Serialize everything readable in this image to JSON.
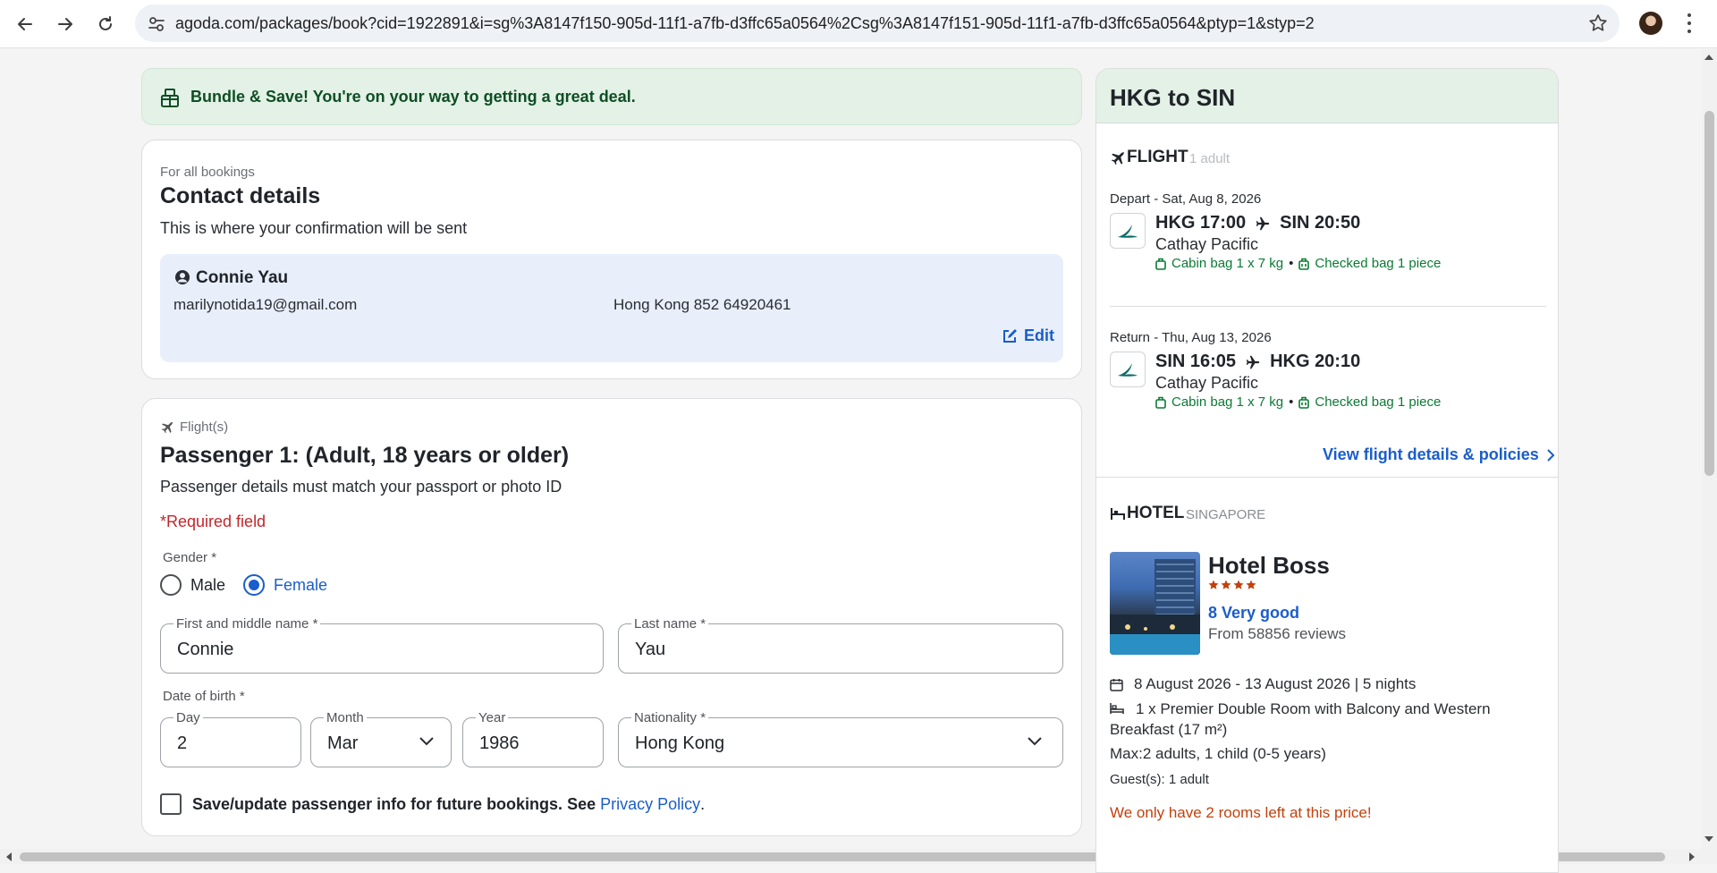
{
  "browser": {
    "url": "agoda.com/packages/book?cid=1922891&i=sg%3A8147f150-905d-11f1-a7fb-d3ffc65a0564%2Csg%3A8147f151-905d-11f1-a7fb-d3ffc65a0564&ptyp=1&styp=2"
  },
  "banner": {
    "text": "Bundle & Save! You're on your way to getting a great deal."
  },
  "contact": {
    "overline": "For all bookings",
    "title": "Contact details",
    "subtitle": "This is where your confirmation will be sent",
    "name": "Connie Yau",
    "email": "marilynotida19@gmail.com",
    "phone": "Hong Kong 852 64920461",
    "edit_label": "Edit"
  },
  "passenger": {
    "overline": "Flight(s)",
    "title": "Passenger 1: (Adult, 18 years or older)",
    "subtitle": "Passenger details must match your passport or photo ID",
    "required_note": "*Required field",
    "gender_label": "Gender *",
    "gender_options": [
      "Male",
      "Female"
    ],
    "gender_selected": "Female",
    "first_name_label": "First and middle name *",
    "first_name_value": "Connie",
    "last_name_label": "Last name *",
    "last_name_value": "Yau",
    "dob_label": "Date of birth *",
    "day_label": "Day",
    "day_value": "2",
    "month_label": "Month",
    "month_value": "Mar",
    "year_label": "Year",
    "year_value": "1986",
    "nationality_label": "Nationality *",
    "nationality_value": "Hong Kong",
    "save_info_text": "Save/update passenger info for future bookings. See",
    "privacy_link": "Privacy Policy",
    "period": "."
  },
  "summary": {
    "route": "HKG to SIN",
    "flight_heading": "FLIGHT",
    "flight_pax": "1 adult",
    "depart": {
      "label": "Depart - Sat, Aug 8, 2026",
      "from": "HKG 17:00",
      "to": "SIN 20:50",
      "airline": "Cathay Pacific",
      "cabin_bag": "Cabin bag 1 x 7 kg",
      "checked_bag": "Checked bag 1 piece"
    },
    "return": {
      "label": "Return - Thu, Aug 13, 2026",
      "from": "SIN 16:05",
      "to": "HKG 20:10",
      "airline": "Cathay Pacific",
      "cabin_bag": "Cabin bag 1 x 7 kg",
      "checked_bag": "Checked bag 1 piece"
    },
    "view_details_link": "View flight details & policies",
    "hotel_heading": "HOTEL",
    "hotel_city": "SINGAPORE",
    "hotel_name": "Hotel Boss",
    "hotel_stars": 4,
    "rating_text": "8 Very good",
    "reviews_text": "From 58856 reviews",
    "dates_text": "8 August 2026 - 13 August 2026 | 5 nights",
    "room_text": "1 x Premier Double Room with Balcony and Western Breakfast (17 m²)",
    "max_text": "Max:2 adults, 1 child (0-5 years)",
    "guests_text": "Guest(s): 1 adult",
    "urgency_text": "We only have 2 rooms left at this price!"
  },
  "colors": {
    "accent_blue": "#1a5dcc",
    "success_green": "#0b7a34",
    "urgency_orange": "#c2410c",
    "required_red": "#c3262b",
    "banner_bg": "#e3f1e6"
  }
}
